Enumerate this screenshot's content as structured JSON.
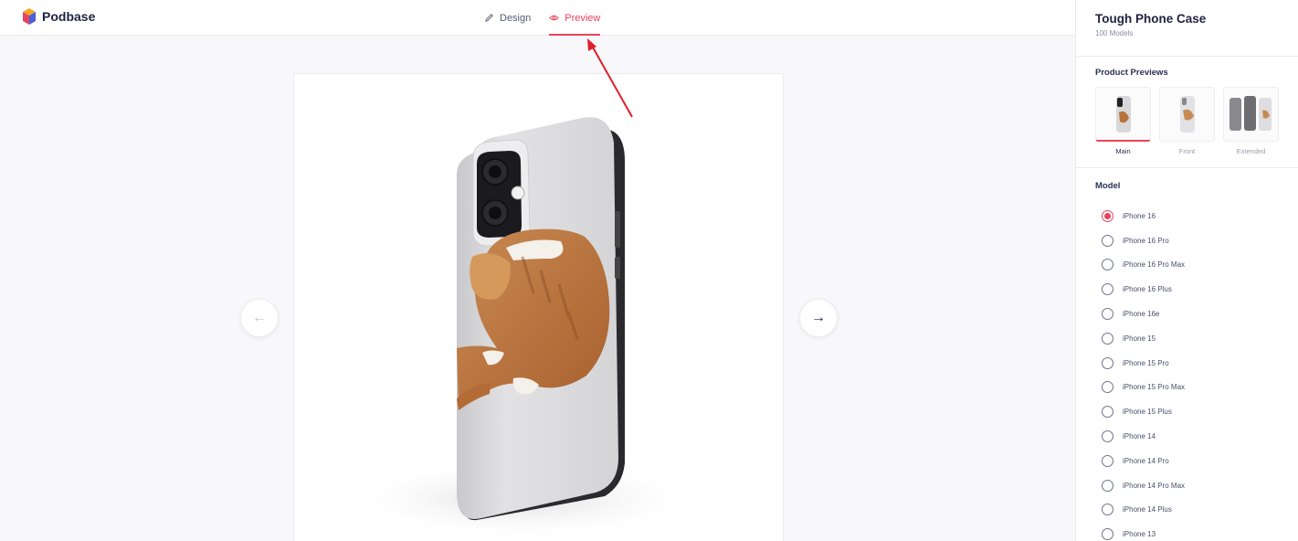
{
  "header": {
    "brand": "Podbase",
    "tabs": [
      {
        "label": "Design",
        "icon": "pencil-icon",
        "active": false
      },
      {
        "label": "Preview",
        "icon": "eye-icon",
        "active": true
      }
    ]
  },
  "preview": {
    "prev_icon": "arrow-left-icon",
    "next_icon": "arrow-right-icon",
    "accent": "#e8435c"
  },
  "sidebar": {
    "title": "Tough Phone Case",
    "subtitle": "100 Models",
    "previews_title": "Product Previews",
    "previews": [
      {
        "label": "Main",
        "selected": true
      },
      {
        "label": "Front",
        "selected": false
      },
      {
        "label": "Extended",
        "selected": false
      }
    ],
    "model_title": "Model",
    "models": [
      {
        "label": "iPhone 16",
        "selected": true
      },
      {
        "label": "iPhone 16 Pro",
        "selected": false
      },
      {
        "label": "iPhone 16 Pro Max",
        "selected": false
      },
      {
        "label": "iPhone 16 Plus",
        "selected": false
      },
      {
        "label": "iPhone 16e",
        "selected": false
      },
      {
        "label": "iPhone 15",
        "selected": false
      },
      {
        "label": "iPhone 15 Pro",
        "selected": false
      },
      {
        "label": "iPhone 15 Pro Max",
        "selected": false
      },
      {
        "label": "iPhone 15 Plus",
        "selected": false
      },
      {
        "label": "iPhone 14",
        "selected": false
      },
      {
        "label": "iPhone 14 Pro",
        "selected": false
      },
      {
        "label": "iPhone 14 Pro Max",
        "selected": false
      },
      {
        "label": "iPhone 14 Plus",
        "selected": false
      },
      {
        "label": "iPhone 13",
        "selected": false
      }
    ]
  }
}
